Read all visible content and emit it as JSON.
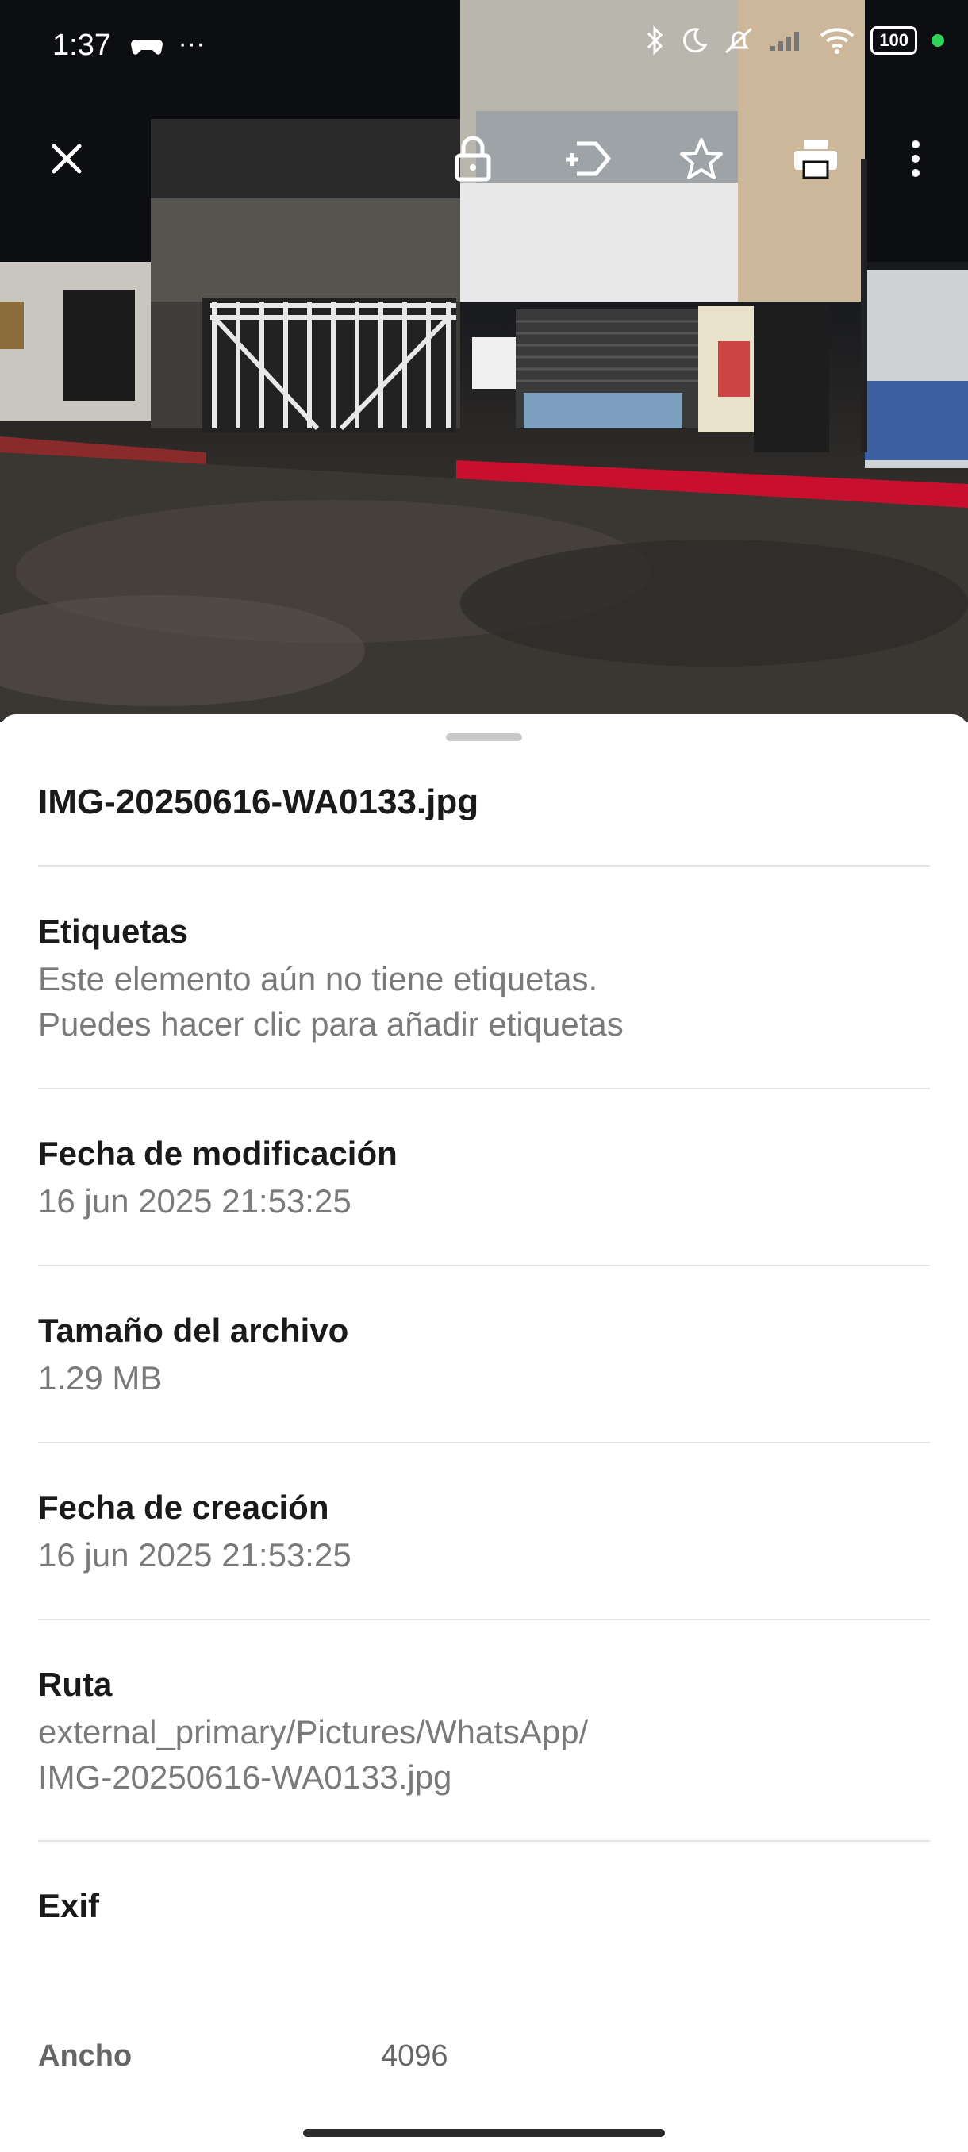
{
  "status_bar": {
    "time": "1:37",
    "left_extra": "···",
    "battery": "100"
  },
  "toolbar": {
    "icons": [
      "close-icon",
      "lock-icon",
      "label-add-icon",
      "star-icon",
      "print-icon",
      "more-vert-icon"
    ]
  },
  "sheet": {
    "file_name": "IMG-20250616-WA0133.jpg",
    "sections": {
      "tags": {
        "title": "Etiquetas",
        "line1": "Este elemento aún no tiene etiquetas.",
        "line2": "Puedes hacer clic para añadir etiquetas"
      },
      "modified": {
        "title": "Fecha de modificación",
        "value": "16 jun 2025 21:53:25"
      },
      "size": {
        "title": "Tamaño del archivo",
        "value": "1.29 MB"
      },
      "created": {
        "title": "Fecha de creación",
        "value": "16 jun 2025 21:53:25"
      },
      "path": {
        "title": "Ruta",
        "line1": "external_primary/Pictures/WhatsApp/",
        "line2": "IMG-20250616-WA0133.jpg"
      },
      "exif": {
        "title": "Exif"
      }
    },
    "exif_rows": [
      {
        "label": "Ancho",
        "value": "4096"
      }
    ]
  },
  "colors": {
    "accent_red": "#c8102e",
    "dot": "#2fd35a"
  }
}
